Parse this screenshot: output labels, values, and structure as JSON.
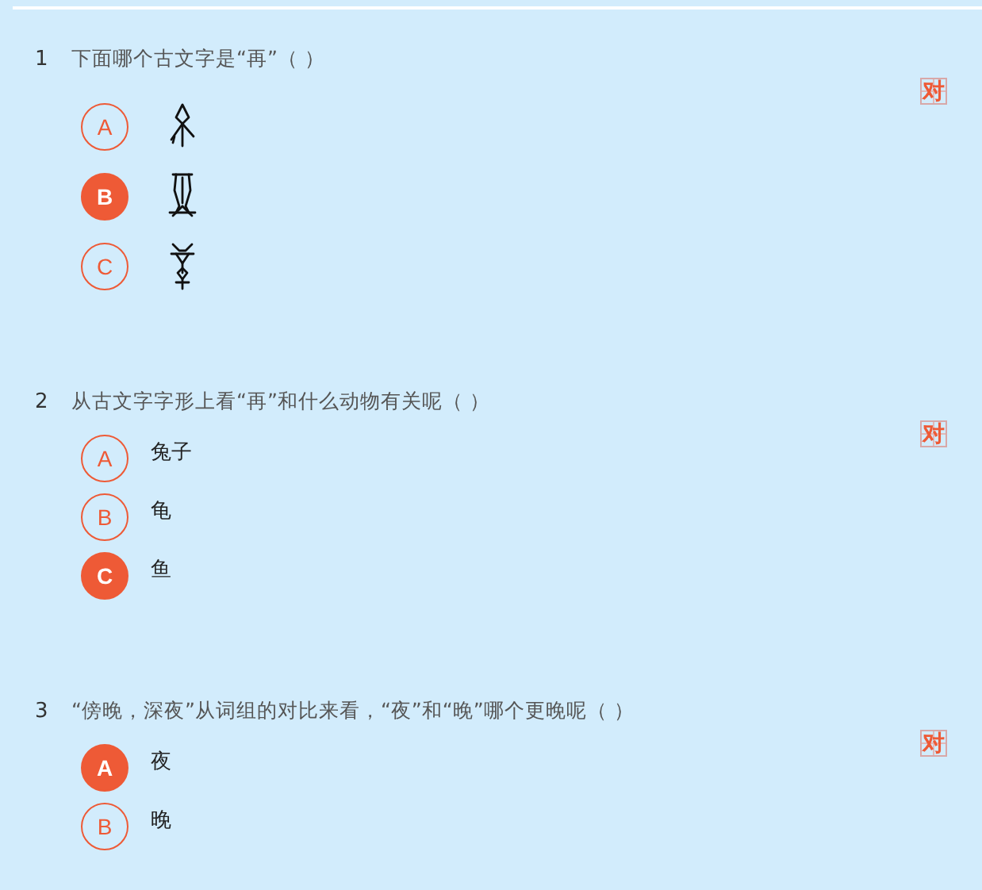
{
  "questions": [
    {
      "number": "1",
      "text": "下面哪个古文字是“再”（  ）",
      "result": "对",
      "options": [
        {
          "letter": "A",
          "kind": "glyph",
          "selected": false
        },
        {
          "letter": "B",
          "kind": "glyph",
          "selected": true
        },
        {
          "letter": "C",
          "kind": "glyph",
          "selected": false
        }
      ]
    },
    {
      "number": "2",
      "text": "从古文字字形上看“再”和什么动物有关呢（  ）",
      "result": "对",
      "options": [
        {
          "letter": "A",
          "kind": "text",
          "label": "兔子",
          "selected": false
        },
        {
          "letter": "B",
          "kind": "text",
          "label": "龟",
          "selected": false
        },
        {
          "letter": "C",
          "kind": "text",
          "label": "鱼",
          "selected": true
        }
      ]
    },
    {
      "number": "3",
      "text": "“傍晚，深夜”从词组的对比来看，“夜”和“晚”哪个更晚呢（  ）",
      "result": "对",
      "options": [
        {
          "letter": "A",
          "kind": "text",
          "label": "夜",
          "selected": true
        },
        {
          "letter": "B",
          "kind": "text",
          "label": "晚",
          "selected": false
        }
      ]
    }
  ]
}
